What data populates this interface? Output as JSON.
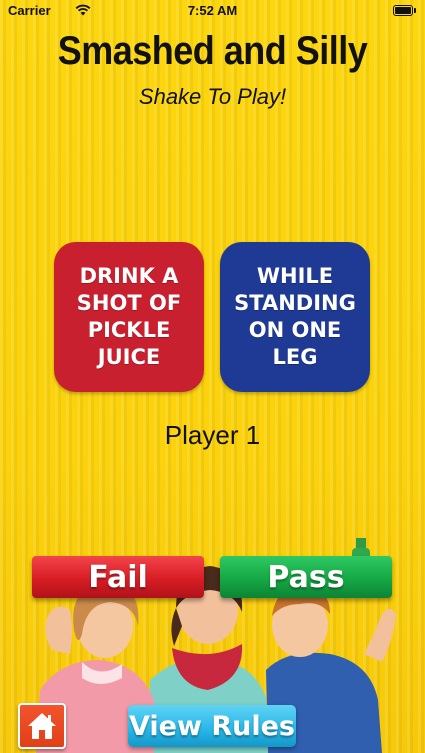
{
  "status_bar": {
    "carrier": "Carrier",
    "time": "7:52 AM",
    "wifi_icon": "wifi-icon",
    "battery_icon": "battery-icon"
  },
  "header": {
    "title": "Smashed and Silly",
    "subtitle": "Shake To Play!"
  },
  "cards": {
    "action": {
      "text": "DRINK A SHOT OF PICKLE JUICE",
      "color": "#c8202e"
    },
    "modifier": {
      "text": "WHILE STANDING ON ONE LEG",
      "color": "#1e3a95"
    }
  },
  "player": {
    "label": "Player 1"
  },
  "buttons": {
    "fail_label": "Fail",
    "pass_label": "Pass",
    "view_rules_label": "View Rules",
    "home_icon": "home-icon"
  },
  "colors": {
    "background": "#fcd60f",
    "fail": "#d81d24",
    "pass": "#15a845",
    "rules": "#27b6e7",
    "home": "#e04018"
  }
}
